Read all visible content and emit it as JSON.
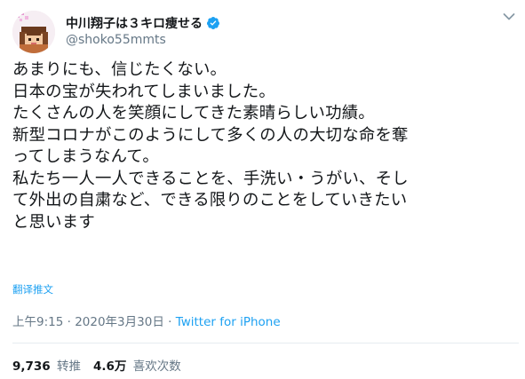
{
  "author": {
    "display_name": "中川翔子は３キロ痩せる",
    "handle": "@shoko55mmts",
    "avatar_icon": "pixel-avatar-icon",
    "verified_icon": "verified-badge-icon"
  },
  "tweet": {
    "lines": [
      "あまりにも、信じたくない。",
      "日本の宝が失われてしまいました。",
      "たくさんの人を笑顔にしてきた素晴らしい功績。",
      "新型コロナがこのようにして多くの人の大切な命を奪",
      "ってしまうなんて。",
      "私たち一人一人できることを、手洗い・うがい、そし",
      "て外出の自粛など、できる限りのことをしていきたい",
      "と思います"
    ],
    "translate_label": "翻译推文"
  },
  "meta": {
    "timestamp": "上午9:15 · 2020年3月30日 ·",
    "source": "Twitter for iPhone"
  },
  "stats": {
    "retweets_count": "9,736",
    "retweets_label": "转推",
    "likes_count": "4.6万",
    "likes_label": "喜欢次数"
  },
  "colors": {
    "accent": "#1da1f2",
    "muted_text": "#657786",
    "divider": "#e6ecf0"
  }
}
